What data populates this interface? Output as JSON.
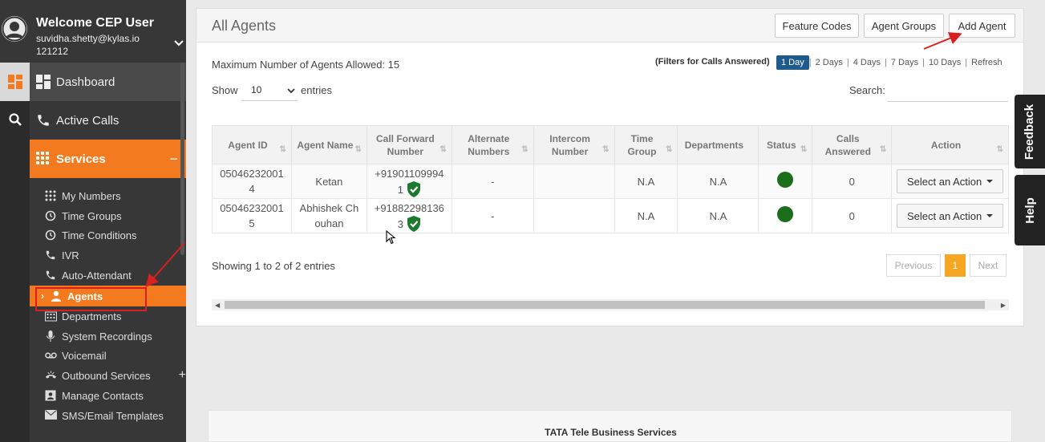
{
  "user": {
    "welcome": "Welcome CEP User",
    "email": "suvidha.shetty@kylas.io",
    "id": "121212"
  },
  "nav": {
    "dashboard": "Dashboard",
    "active_calls": "Active Calls",
    "services": "Services",
    "services_toggle": "−",
    "sub": {
      "my_numbers": "My Numbers",
      "time_groups": "Time Groups",
      "time_conditions": "Time Conditions",
      "ivr": "IVR",
      "auto_attendant": "Auto-Attendant",
      "agents": "Agents",
      "departments": "Departments",
      "system_recordings": "System Recordings",
      "voicemail": "Voicemail",
      "outbound_services": "Outbound Services",
      "outbound_toggle": "+",
      "manage_contacts": "Manage Contacts",
      "sms_email_templates": "SMS/Email Templates"
    }
  },
  "page": {
    "title": "All Agents",
    "buttons": {
      "feature_codes": "Feature Codes",
      "agent_groups": "Agent Groups",
      "add_agent": "Add Agent"
    },
    "max_agents": "Maximum Number of Agents Allowed: 15",
    "filters_label": "(Filters for Calls Answered)",
    "filters": [
      "1 Day",
      "2 Days",
      "4 Days",
      "7 Days",
      "10 Days",
      "Refresh"
    ],
    "filters_active": "1 Day",
    "show_label": "Show",
    "entries_value": "10",
    "entries_label": "entries",
    "search_label": "Search:",
    "search_value": ""
  },
  "table": {
    "columns": [
      "Agent ID",
      "Agent Name",
      "Call Forward Number",
      "Alternate Numbers",
      "Intercom Number",
      "Time Group",
      "Departments",
      "Status",
      "Calls Answered",
      "Action"
    ],
    "rows": [
      {
        "agent_id": "05046232001 4",
        "agent_name": "Ketan",
        "call_forward": "+91901109994 1",
        "verified": true,
        "alternate": "-",
        "intercom": "",
        "time_group": "N.A",
        "departments": "N.A",
        "status_color": "#1b6e1b",
        "calls_answered": "0",
        "action": "Select an Action"
      },
      {
        "agent_id": "05046232001 5",
        "agent_name": "Abhishek Ch ouhan",
        "call_forward": "+91882298136 3",
        "verified": true,
        "alternate": "-",
        "intercom": "",
        "time_group": "N.A",
        "departments": "N.A",
        "status_color": "#1b6e1b",
        "calls_answered": "0",
        "action": "Select an Action"
      }
    ]
  },
  "pagination": {
    "summary": "Showing 1 to 2 of 2 entries",
    "previous": "Previous",
    "current": "1",
    "next": "Next"
  },
  "sidetabs": {
    "feedback": "Feedback",
    "help": "Help"
  },
  "footer": {
    "text": "TATA Tele Business Services"
  },
  "colors": {
    "accent": "#f47a20",
    "active_filter": "#1e5a8c",
    "page_active": "#f5a623",
    "status_green": "#1b6e1b",
    "annotation": "#d82020"
  }
}
